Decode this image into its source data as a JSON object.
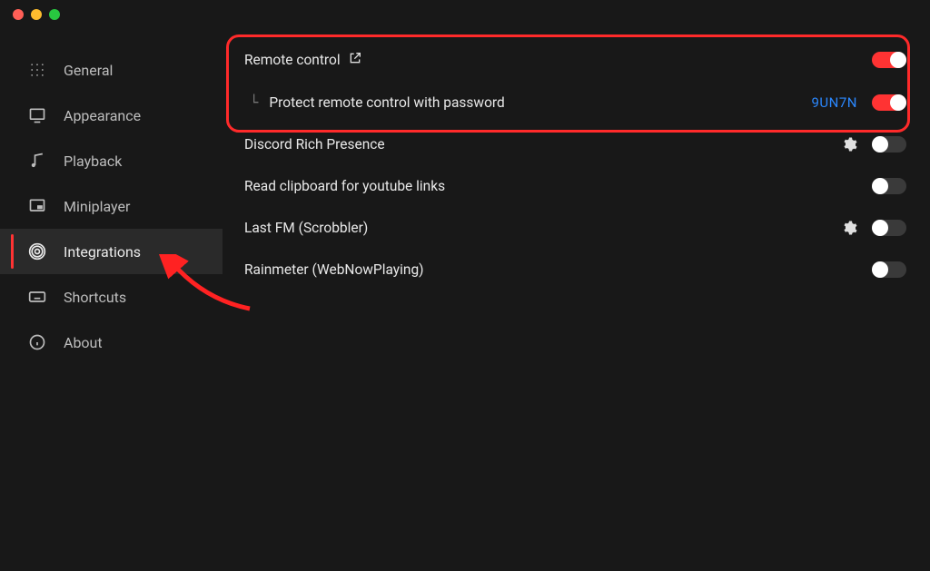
{
  "sidebar": {
    "items": [
      {
        "label": "General"
      },
      {
        "label": "Appearance"
      },
      {
        "label": "Playback"
      },
      {
        "label": "Miniplayer"
      },
      {
        "label": "Integrations"
      },
      {
        "label": "Shortcuts"
      },
      {
        "label": "About"
      }
    ]
  },
  "settings": {
    "remote_control": {
      "label": "Remote control",
      "on": true
    },
    "protect_remote": {
      "prefix": "└",
      "label": "Protect remote control with password",
      "code": "9UN7N",
      "on": true
    },
    "discord": {
      "label": "Discord Rich Presence",
      "has_gear": true,
      "on": false
    },
    "clipboard": {
      "label": "Read clipboard for youtube links",
      "on": false
    },
    "lastfm": {
      "label": "Last FM (Scrobbler)",
      "has_gear": true,
      "on": false
    },
    "rainmeter": {
      "label": "Rainmeter (WebNowPlaying)",
      "on": false
    }
  },
  "colors": {
    "accent": "#ff3333",
    "link": "#2b88ff"
  }
}
